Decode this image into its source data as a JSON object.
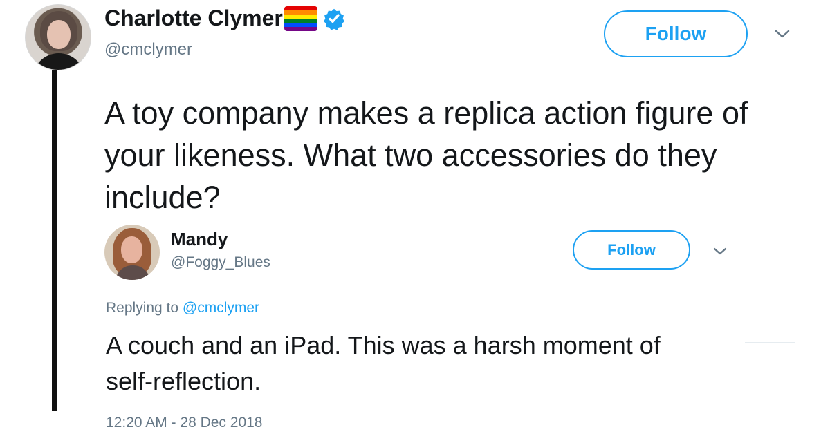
{
  "original_tweet": {
    "author": {
      "name": "Charlotte Clymer",
      "handle": "@cmclymer",
      "avatar_icon": "user-avatar",
      "name_emoji_icon": "rainbow-flag-icon",
      "verified_icon": "verified-badge-icon"
    },
    "follow_label": "Follow",
    "menu_icon": "chevron-down-icon",
    "text": "A toy company makes a replica action figure of your likeness. What two accessories do they include?"
  },
  "reply_tweet": {
    "author": {
      "name": "Mandy",
      "handle": "@Foggy_Blues",
      "avatar_icon": "user-avatar"
    },
    "follow_label": "Follow",
    "menu_icon": "chevron-down-icon",
    "replying_to_prefix": "Replying to",
    "replying_to_handle": "@cmclymer",
    "text": "A couch and an iPad. This was a harsh moment of self-reflection.",
    "timestamp": "12:20 AM - 28 Dec 2018"
  },
  "colors": {
    "accent_blue": "#1da1f2",
    "muted_text": "#657786",
    "main_text": "#14171a",
    "thread_line": "#111111"
  }
}
